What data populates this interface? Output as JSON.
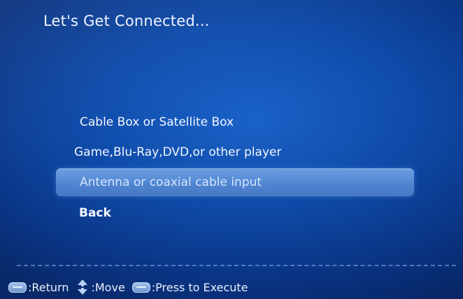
{
  "title": "Let's Get Connected...",
  "menu": {
    "items": [
      {
        "label": "Cable Box or Satellite Box"
      },
      {
        "label": "Game,Blu-Ray,DVD,or other player"
      },
      {
        "label": "Antenna or coaxial cable input"
      },
      {
        "label": "Back"
      }
    ],
    "selected": "Antenna or coaxial cable input"
  },
  "footer": {
    "return_label": ":Return",
    "move_label": ":Move",
    "execute_label": ":Press to Execute",
    "icons": [
      "menu-key-icon",
      "up-down-arrows-icon",
      "enter-key-icon"
    ]
  }
}
